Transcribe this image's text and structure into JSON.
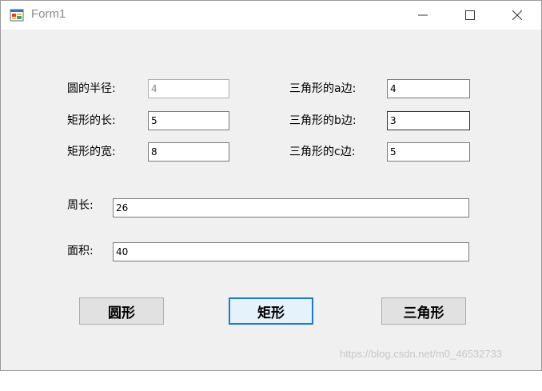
{
  "window": {
    "title": "Form1"
  },
  "labels": {
    "circle_radius": "圆的半径:",
    "rect_length": "矩形的长:",
    "rect_width": "矩形的宽:",
    "tri_a": "三角形的a边:",
    "tri_b": "三角形的b边:",
    "tri_c": "三角形的c边:",
    "perimeter": "周长:",
    "area": "面积:"
  },
  "fields": {
    "circle_radius": "4",
    "rect_length": "5",
    "rect_width": "8",
    "tri_a": "4",
    "tri_b": "3",
    "tri_c": "5",
    "perimeter": "26",
    "area": "40"
  },
  "buttons": {
    "circle": "圆形",
    "rectangle": "矩形",
    "triangle": "三角形"
  },
  "watermark": "https://blog.csdn.net/m0_46532733",
  "colors": {
    "form_bg": "#f0f0f0",
    "default_button_border": "#1a7bd0",
    "disabled_text": "#8a8a8a"
  }
}
